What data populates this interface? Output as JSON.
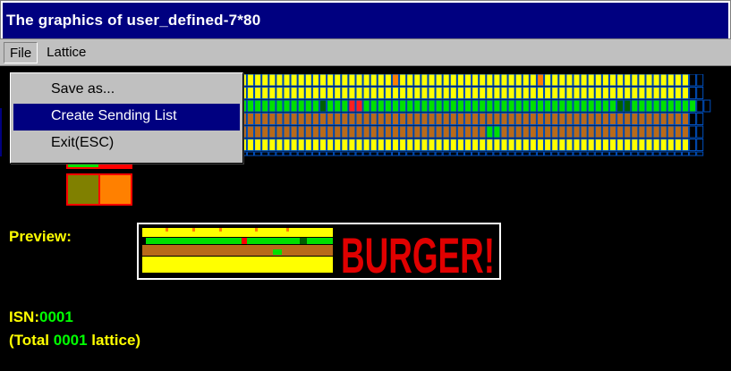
{
  "window": {
    "title": "The graphics of user_defined-7*80"
  },
  "menu": {
    "file": "File",
    "lattice": "Lattice"
  },
  "file_menu": {
    "items": [
      "Save as...",
      "Create Sending List",
      "Exit(ESC)"
    ],
    "highlighted_index": 1
  },
  "preview": {
    "label": "Preview:",
    "text": "BURGER!"
  },
  "status": {
    "isn_label": "ISN:",
    "isn_value": "0001",
    "total_prefix": "(Total ",
    "total_value": "0001",
    "total_suffix": " lattice)"
  },
  "colors": {
    "yellow": "#ffff00",
    "green": "#00e000",
    "dark_green": "#006000",
    "brown": "#b86a1a",
    "orange": "#ff8000",
    "red": "#ff2020",
    "olive": "#808000",
    "grid_blue": "#0050c0",
    "highlight": "#000080"
  },
  "lattice": {
    "rows": [
      "YYYYYYYYOYYYYYYYYYYYYYYYYYYYYYYYYYYOYYYYYYYYYYYYYYYYYYYOYYYYYYYYYYYYYYYYYYYYKK",
      "YYYYYYYYYYYYYYYYYYYYYYYYYYYYYYYYYYYYYYYYYYYYYYYYYYYYYYYYYYYYYYYYYYYYYYYYYYYYKK",
      "GGGGGGGGGGGGGGGGGGGGGGGGGDGGGRRGGGGGGGGGGGGGGGGGGGGGGGGGGGGGGGGGGGDDGGGGGGGGGKK",
      "BBBBBBBBBBBBBBBBBBBBBBBBBBBBBBBBBBBBBBBBBBBBBBBBBBBBBBBBBBBBBBBBBBBBBBBBBBBBKK",
      "BBBBBBBBBBBBBBBBBBBBBBBBBBBBBBBBBBBBBBBBBBBBBBBBGGBBBBBBBBBBBBBBBBBBBBBBBBBBKK",
      "YYYYYYYYYYYYYYYYYYYYYYYYYYYYYYYYYYYYYYYYYYYYYYYYYYYYYYYYYYYYYYYYYYYYYYYYYYYYKK",
      "KKKKKKKKKKKKKKKKKKKKKKKKKKKKKKKKKKKKKKKKKKKKKKKKKKKKKKKKKKKKKKKKKKKKKKKKKKKKKK"
    ]
  }
}
